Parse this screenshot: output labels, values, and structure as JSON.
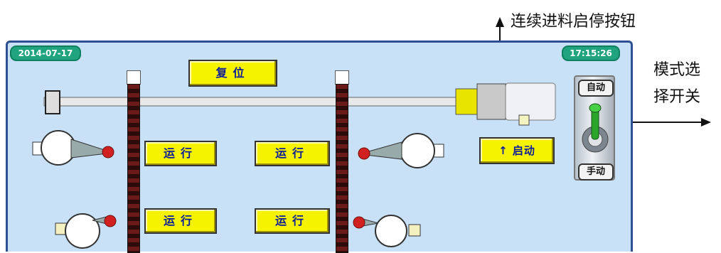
{
  "annotations": {
    "continuous_feed": "连续进料启停按钮",
    "mode_switch_line1": "模式选",
    "mode_switch_line2": "择开关"
  },
  "panel": {
    "date": "2014-07-17",
    "time": "17:15:26",
    "reset_button": "复位",
    "start_button": "启动",
    "start_arrow": "↑",
    "run_buttons": [
      "运行",
      "运行",
      "运行",
      "运行"
    ],
    "mode_switch": {
      "top_label": "自动",
      "bottom_label": "手动"
    }
  },
  "colors": {
    "panel_bg": "#c8e1f7",
    "panel_border": "#2f4f93",
    "button_yellow": "#f6f300",
    "pill_green": "#1fa47f"
  }
}
